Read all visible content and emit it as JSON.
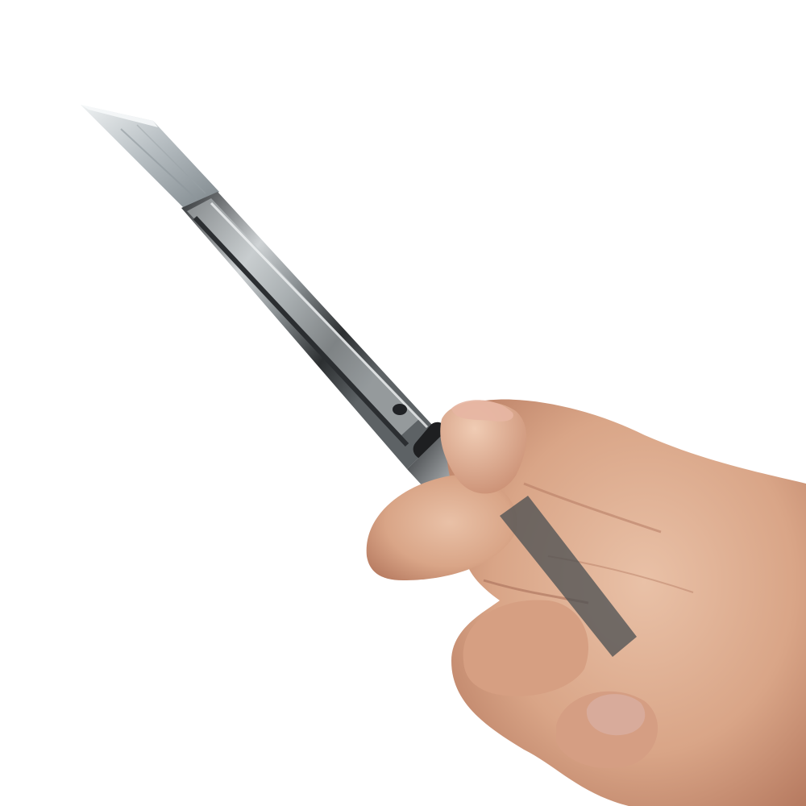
{
  "scene": {
    "background_color": "#ffffff",
    "subject": "utility-knife-held-in-hand",
    "colors": {
      "blade_light": "#e4e8ea",
      "blade_mid": "#aab2b7",
      "blade_dark": "#6f787d",
      "handle_metal_light": "#d9dcdd",
      "handle_metal_dark": "#3a3d40",
      "grip_black": "#1e1f21",
      "skin_light": "#e2b59a",
      "skin_mid": "#cf967a",
      "skin_dark": "#a86d55",
      "nail": "#d6a896"
    }
  }
}
